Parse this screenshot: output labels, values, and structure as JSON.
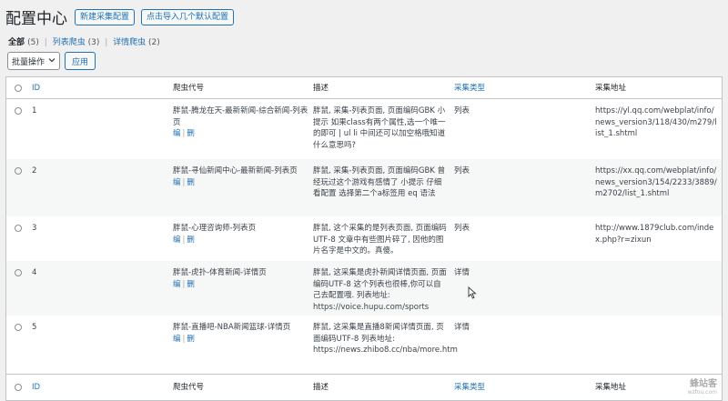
{
  "header": {
    "title": "配置中心",
    "new_button": "新建采集配置",
    "import_button": "点击导入几个默认配置"
  },
  "filters": [
    {
      "label": "全部",
      "count": "(5)"
    },
    {
      "label": "列表爬虫",
      "count": "(3)"
    },
    {
      "label": "详情爬虫",
      "count": "(2)"
    }
  ],
  "bulk": {
    "select_label": "批量操作",
    "apply_label": "应用"
  },
  "columns": {
    "id": "ID",
    "name": "爬虫代号",
    "desc": "描述",
    "type": "采集类型",
    "url": "采集地址"
  },
  "row_actions": {
    "edit": "编",
    "delete": "删"
  },
  "rows": [
    {
      "id": "1",
      "name": "胖鼠-腾龙在天-最新新闻-综合新闻-列表页",
      "desc": "胖鼠, 采集-列表页面, 页面编码GBK 小提示 如果class有两个属性,选一个唯一的即可 | ul li 中间还可以加空格哦知道什么意思吗?",
      "type": "列表",
      "url": "https://yl.qq.com/webplat/info/news_version3/118/430/m279/list_1.shtml"
    },
    {
      "id": "2",
      "name": "胖鼠-寻仙新闻中心-最新新闻-列表页",
      "desc": "胖鼠, 采集-列表页面, 页面编码GBK 曾经玩过这个游戏有感情了 小提示 仔细看配置 选择第二个a标签用 eq 语法",
      "type": "列表",
      "url": "https://xx.qq.com/webplat/info/news_version3/154/2233/3889/m2702/list_1.shtml"
    },
    {
      "id": "3",
      "name": "胖鼠-心理咨询师-列表页",
      "desc": "胖鼠, 这个采集的是列表页面, 页面编码UTF-8 文章中有些图片碎了, 因他的图片名字是中文的。真傻。",
      "type": "列表",
      "url": "http://www.1879club.com/index.php?r=zixun"
    },
    {
      "id": "4",
      "name": "胖鼠-虎扑-体育新闻-详情页",
      "desc": "胖鼠, 这采集是虎扑新闻详情页面, 页面编码UTF-8 这个列表也很棒,你可以自己去配置哦. 列表地址: https://voice.hupu.com/sports",
      "type": "详情",
      "url": ""
    },
    {
      "id": "5",
      "name": "胖鼠-直播吧-NBA新闻篮球-详情页",
      "desc": "胖鼠, 这采集是直播8新闻详情页面, 页面编码UTF-8 列表地址: https://news.zhibo8.cc/nba/more.htm",
      "type": "详情",
      "url": ""
    }
  ],
  "watermark": {
    "main": "蜂站客",
    "sub": "wzfou.com"
  },
  "colors": {
    "link": "#2271b1",
    "background": "#f0f0f1",
    "border": "#c3c4c7"
  },
  "icons": {
    "cursor": "mouse-pointer-icon",
    "dropdown": "chevron-down-icon"
  }
}
